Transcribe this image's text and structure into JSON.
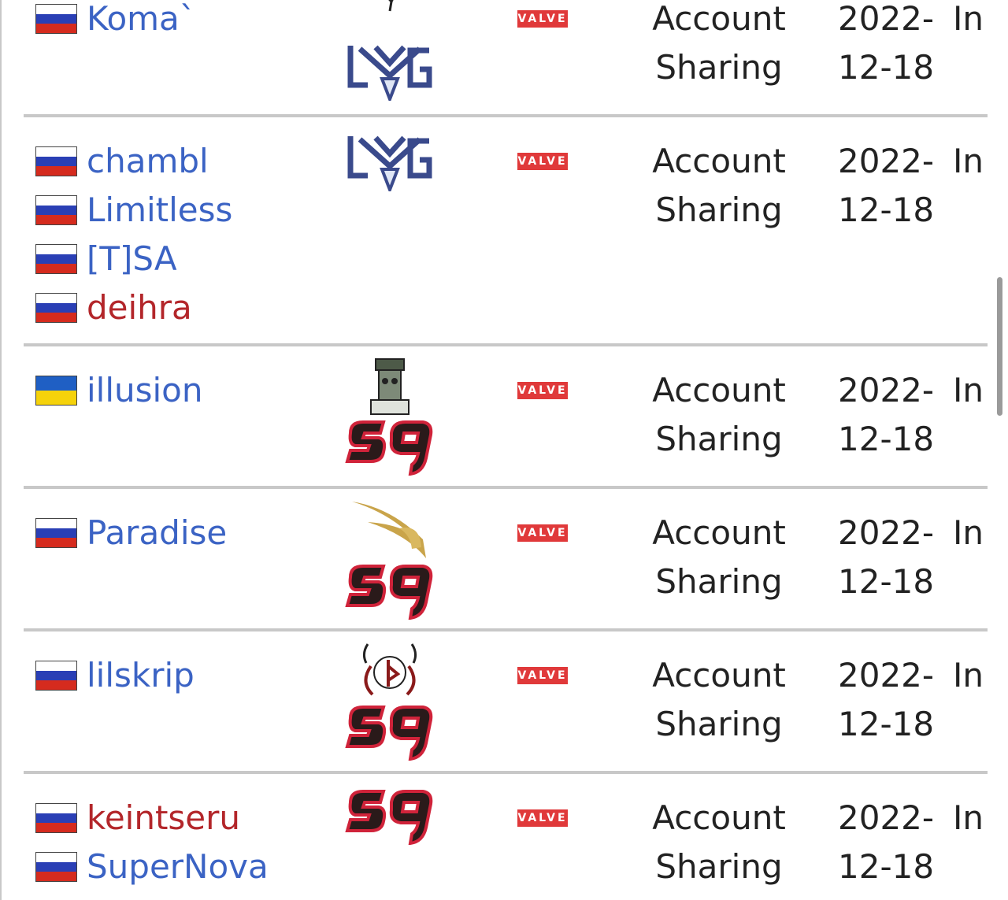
{
  "colors": {
    "link_blue": "#3b63c4",
    "link_red": "#b3262a",
    "valve_badge": "#e0393a",
    "divider": "#c8c8c8"
  },
  "valve_label": "VALVE",
  "rows": [
    {
      "players": [
        {
          "name": "Koma`",
          "flag": "russia",
          "color": "blue"
        }
      ],
      "logos": [
        "virtus-pro-logo",
        "lvg-logo"
      ],
      "reason": [
        "Account",
        "Sharing"
      ],
      "date": [
        "2022-",
        "12-18"
      ],
      "status": "In"
    },
    {
      "players": [
        {
          "name": "chambl",
          "flag": "russia",
          "color": "blue"
        },
        {
          "name": "Limitless",
          "flag": "russia",
          "color": "blue"
        },
        {
          "name": "[T]SA",
          "flag": "russia",
          "color": "blue"
        },
        {
          "name": "deihra",
          "flag": "russia",
          "color": "red"
        }
      ],
      "logos": [
        "lvg-logo"
      ],
      "reason": [
        "Account",
        "Sharing"
      ],
      "date": [
        "2022-",
        "12-18"
      ],
      "status": "In"
    },
    {
      "players": [
        {
          "name": "illusion",
          "flag": "ukraine",
          "color": "blue"
        }
      ],
      "logos": [
        "totem-logo",
        "sg-logo"
      ],
      "reason": [
        "Account",
        "Sharing"
      ],
      "date": [
        "2022-",
        "12-18"
      ],
      "status": "In"
    },
    {
      "players": [
        {
          "name": "Paradise",
          "flag": "russia",
          "color": "blue"
        }
      ],
      "logos": [
        "gold-helmet-logo",
        "sg-logo"
      ],
      "reason": [
        "Account",
        "Sharing"
      ],
      "date": [
        "2022-",
        "12-18"
      ],
      "status": "In"
    },
    {
      "players": [
        {
          "name": "lilskrip",
          "flag": "russia",
          "color": "blue"
        }
      ],
      "logos": [
        "demon-logo",
        "sg-logo"
      ],
      "reason": [
        "Account",
        "Sharing"
      ],
      "date": [
        "2022-",
        "12-18"
      ],
      "status": "In"
    },
    {
      "players": [
        {
          "name": "keintseru",
          "flag": "russia",
          "color": "red"
        },
        {
          "name": "SuperNova",
          "flag": "russia",
          "color": "blue"
        }
      ],
      "logos": [
        "sg-logo"
      ],
      "reason": [
        "Account",
        "Sharing"
      ],
      "date": [
        "2022-",
        "12-18"
      ],
      "status": "In"
    }
  ]
}
